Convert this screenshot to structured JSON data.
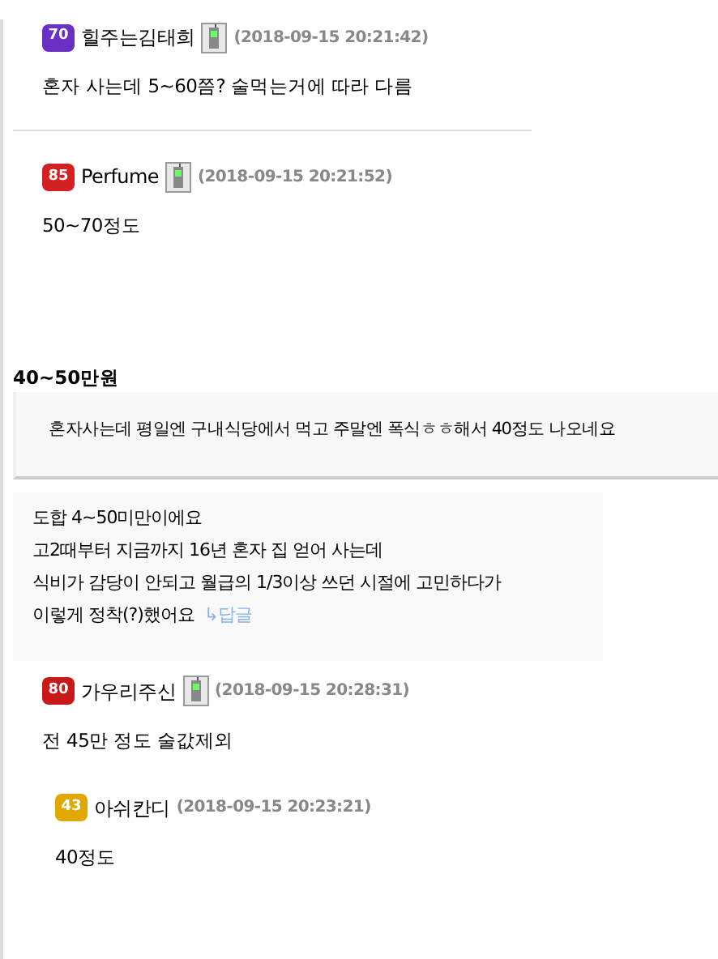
{
  "comments_top": [
    {
      "level": "70",
      "color": "#6a2fc4",
      "author": "힐주는김태희",
      "mobile": true,
      "date": "(2018-09-15 20:21:42)",
      "text": "혼자 사는데 5~60쯤? 술먹는거에 따라 다름"
    },
    {
      "level": "85",
      "color": "#d42020",
      "author": "Perfume",
      "mobile": true,
      "date": "(2018-09-15 20:21:52)",
      "text": "50~70정도"
    }
  ],
  "heading": "40~50만원",
  "quote": "혼자사는데 평일엔 구내식당에서 먹고 주말엔 폭식ㅎㅎ해서 40정도 나오네요",
  "excerpt": {
    "lines": [
      "도합 4~50미만이에요",
      "고2때부터 지금까지 16년 혼자 집 얻어 사는데",
      "식비가 감당이 안되고 월급의 1/3이상 쓰던 시절에 고민하다가",
      "이렇게 정착(?)했어요"
    ],
    "reply_link": "↳답글"
  },
  "comments_bottom": [
    {
      "level": "80",
      "color": "#c81818",
      "author": "가우리주신",
      "mobile": true,
      "date": "(2018-09-15 20:28:31)",
      "text": "전 45만 정도 술값제외",
      "children": [
        {
          "level": "43",
          "color": "#e0a800",
          "author": "아쉬칸디",
          "mobile": false,
          "date": "(2018-09-15 20:23:21)",
          "text": "40정도"
        }
      ]
    }
  ]
}
